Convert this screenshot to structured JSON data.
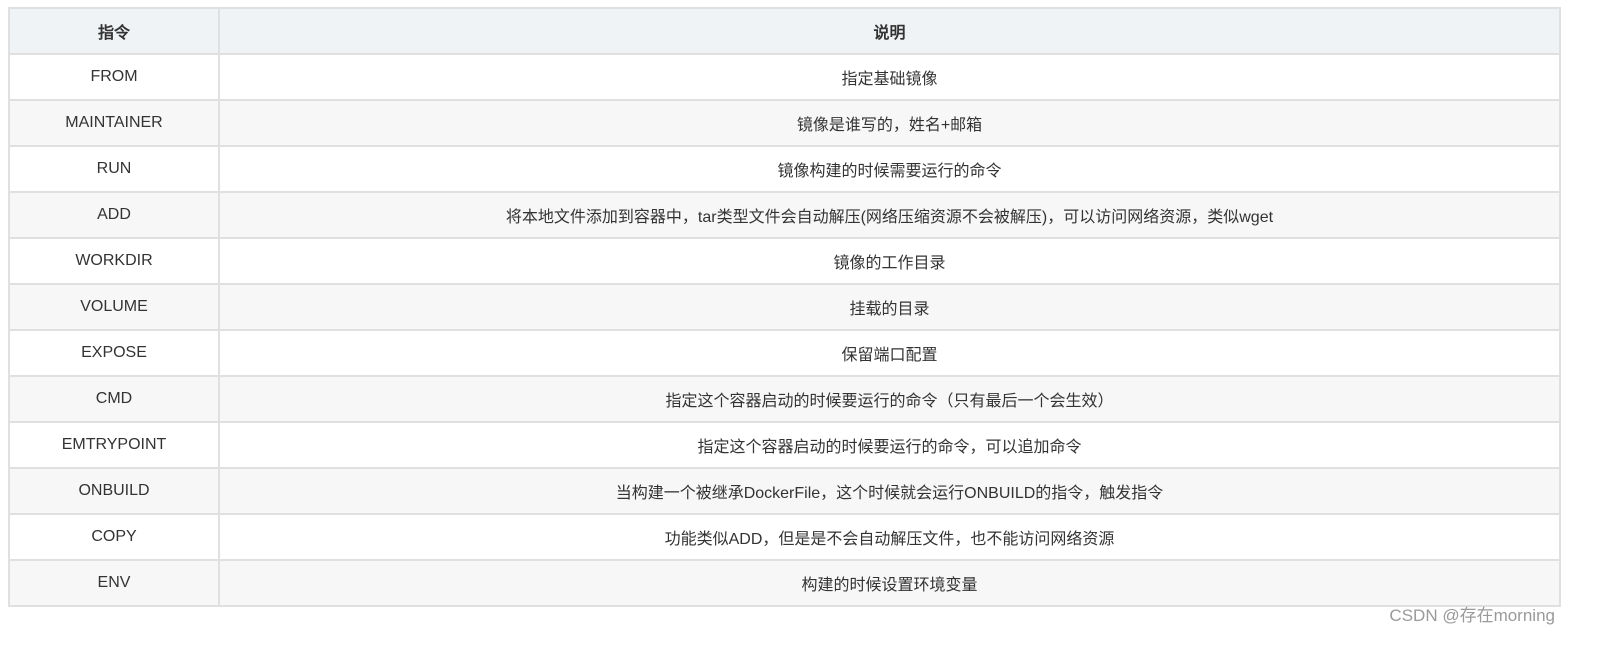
{
  "headers": [
    "指令",
    "说明"
  ],
  "rows": [
    {
      "cmd": "FROM",
      "desc": "指定基础镜像"
    },
    {
      "cmd": "MAINTAINER",
      "desc": "镜像是谁写的，姓名+邮箱"
    },
    {
      "cmd": "RUN",
      "desc": "镜像构建的时候需要运行的命令"
    },
    {
      "cmd": "ADD",
      "desc": "将本地文件添加到容器中，tar类型文件会自动解压(网络压缩资源不会被解压)，可以访问网络资源，类似wget"
    },
    {
      "cmd": "WORKDIR",
      "desc": "镜像的工作目录"
    },
    {
      "cmd": "VOLUME",
      "desc": "挂载的目录"
    },
    {
      "cmd": "EXPOSE",
      "desc": "保留端口配置"
    },
    {
      "cmd": "CMD",
      "desc": "指定这个容器启动的时候要运行的命令（只有最后一个会生效）"
    },
    {
      "cmd": "EMTRYPOINT",
      "desc": "指定这个容器启动的时候要运行的命令，可以追加命令"
    },
    {
      "cmd": "ONBUILD",
      "desc": "当构建一个被继承DockerFile，这个时候就会运行ONBUILD的指令，触发指令"
    },
    {
      "cmd": "COPY",
      "desc": "功能类似ADD，但是是不会自动解压文件，也不能访问网络资源"
    },
    {
      "cmd": "ENV",
      "desc": "构建的时候设置环境变量"
    }
  ],
  "watermark": "CSDN @存在morning"
}
